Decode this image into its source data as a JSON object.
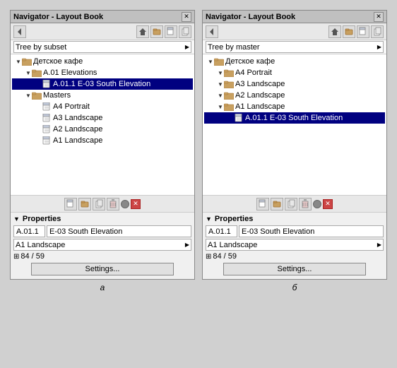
{
  "panels": [
    {
      "id": "panel-a",
      "title": "Navigator - Layout Book",
      "dropdown_value": "Tree by subset",
      "tree": [
        {
          "level": 0,
          "expand": "▼",
          "icon": "folder",
          "label": "Детское кафе",
          "selected": false
        },
        {
          "level": 1,
          "expand": "▼",
          "icon": "folder",
          "label": "A.01 Elevations",
          "selected": false
        },
        {
          "level": 2,
          "expand": "",
          "icon": "page",
          "label": "A.01.1 E-03 South Elevation",
          "selected": true
        },
        {
          "level": 1,
          "expand": "▼",
          "icon": "folder",
          "label": "Masters",
          "selected": false
        },
        {
          "level": 2,
          "expand": "",
          "icon": "page",
          "label": "A4 Portrait",
          "selected": false
        },
        {
          "level": 2,
          "expand": "",
          "icon": "page",
          "label": "A3 Landscape",
          "selected": false
        },
        {
          "level": 2,
          "expand": "",
          "icon": "page",
          "label": "A2 Landscape",
          "selected": false
        },
        {
          "level": 2,
          "expand": "",
          "icon": "page",
          "label": "A1 Landscape",
          "selected": false
        }
      ],
      "properties": {
        "field1": "A.01.1",
        "field2": "E-03 South Elevation",
        "dropdown": "A1 Landscape",
        "nav": "84 / 59",
        "settings_label": "Settings..."
      },
      "caption": "а"
    },
    {
      "id": "panel-b",
      "title": "Navigator - Layout Book",
      "dropdown_value": "Tree by master",
      "tree": [
        {
          "level": 0,
          "expand": "▼",
          "icon": "folder",
          "label": "Детское кафе",
          "selected": false
        },
        {
          "level": 1,
          "expand": "▼",
          "icon": "folder",
          "label": "A4 Portrait",
          "selected": false
        },
        {
          "level": 1,
          "expand": "▼",
          "icon": "folder",
          "label": "A3 Landscape",
          "selected": false
        },
        {
          "level": 1,
          "expand": "▼",
          "icon": "folder",
          "label": "A2 Landscape",
          "selected": false
        },
        {
          "level": 1,
          "expand": "▼",
          "icon": "folder",
          "label": "A1 Landscape",
          "selected": false
        },
        {
          "level": 2,
          "expand": "",
          "icon": "page",
          "label": "A.01.1 E-03 South Elevation",
          "selected": true
        }
      ],
      "properties": {
        "field1": "A.01.1",
        "field2": "E-03 South Elevation",
        "dropdown": "A1 Landscape",
        "nav": "84 / 59",
        "settings_label": "Settings..."
      },
      "caption": "б"
    }
  ],
  "toolbar_icons": [
    "📄",
    "📁",
    "📋",
    "💾"
  ],
  "bottom_toolbar_icons": [
    "📄",
    "📁",
    "📋",
    "💾",
    "●",
    "✕"
  ]
}
